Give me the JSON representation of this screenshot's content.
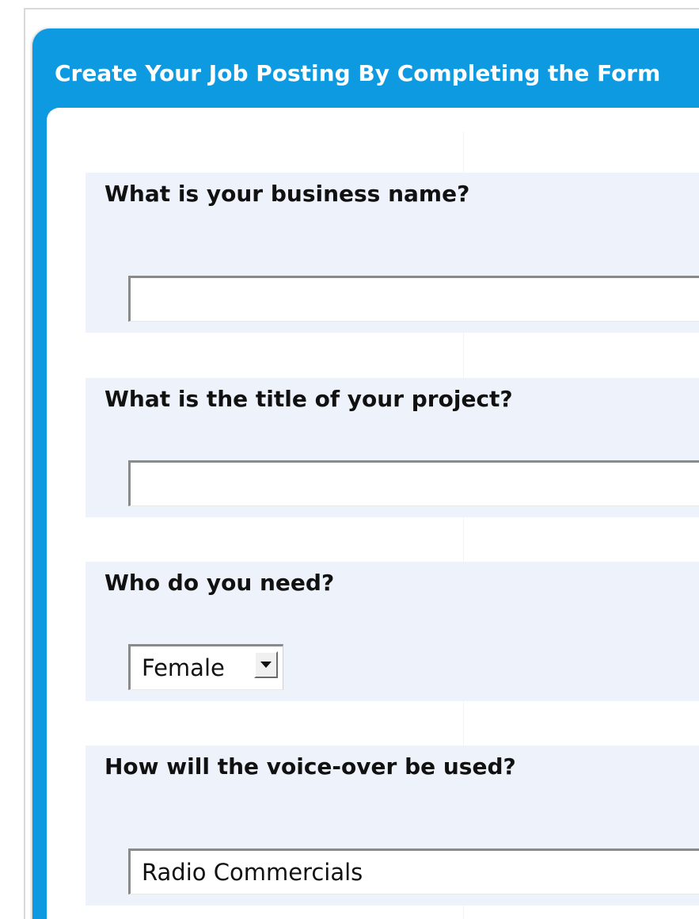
{
  "form": {
    "title": "Create Your Job Posting By Completing the Form",
    "fields": [
      {
        "label": "What is your business name?",
        "value": "",
        "type": "text"
      },
      {
        "label": "What is the title of your project?",
        "value": "",
        "type": "text"
      },
      {
        "label": "Who do you need?",
        "value": "Female",
        "type": "select"
      },
      {
        "label": "How will the voice-over be used?",
        "value": "Radio Commercials",
        "type": "select"
      }
    ]
  },
  "colors": {
    "panel": "#0d9ae0",
    "field_background": "#eef2fb",
    "title_text": "#ffffff"
  }
}
